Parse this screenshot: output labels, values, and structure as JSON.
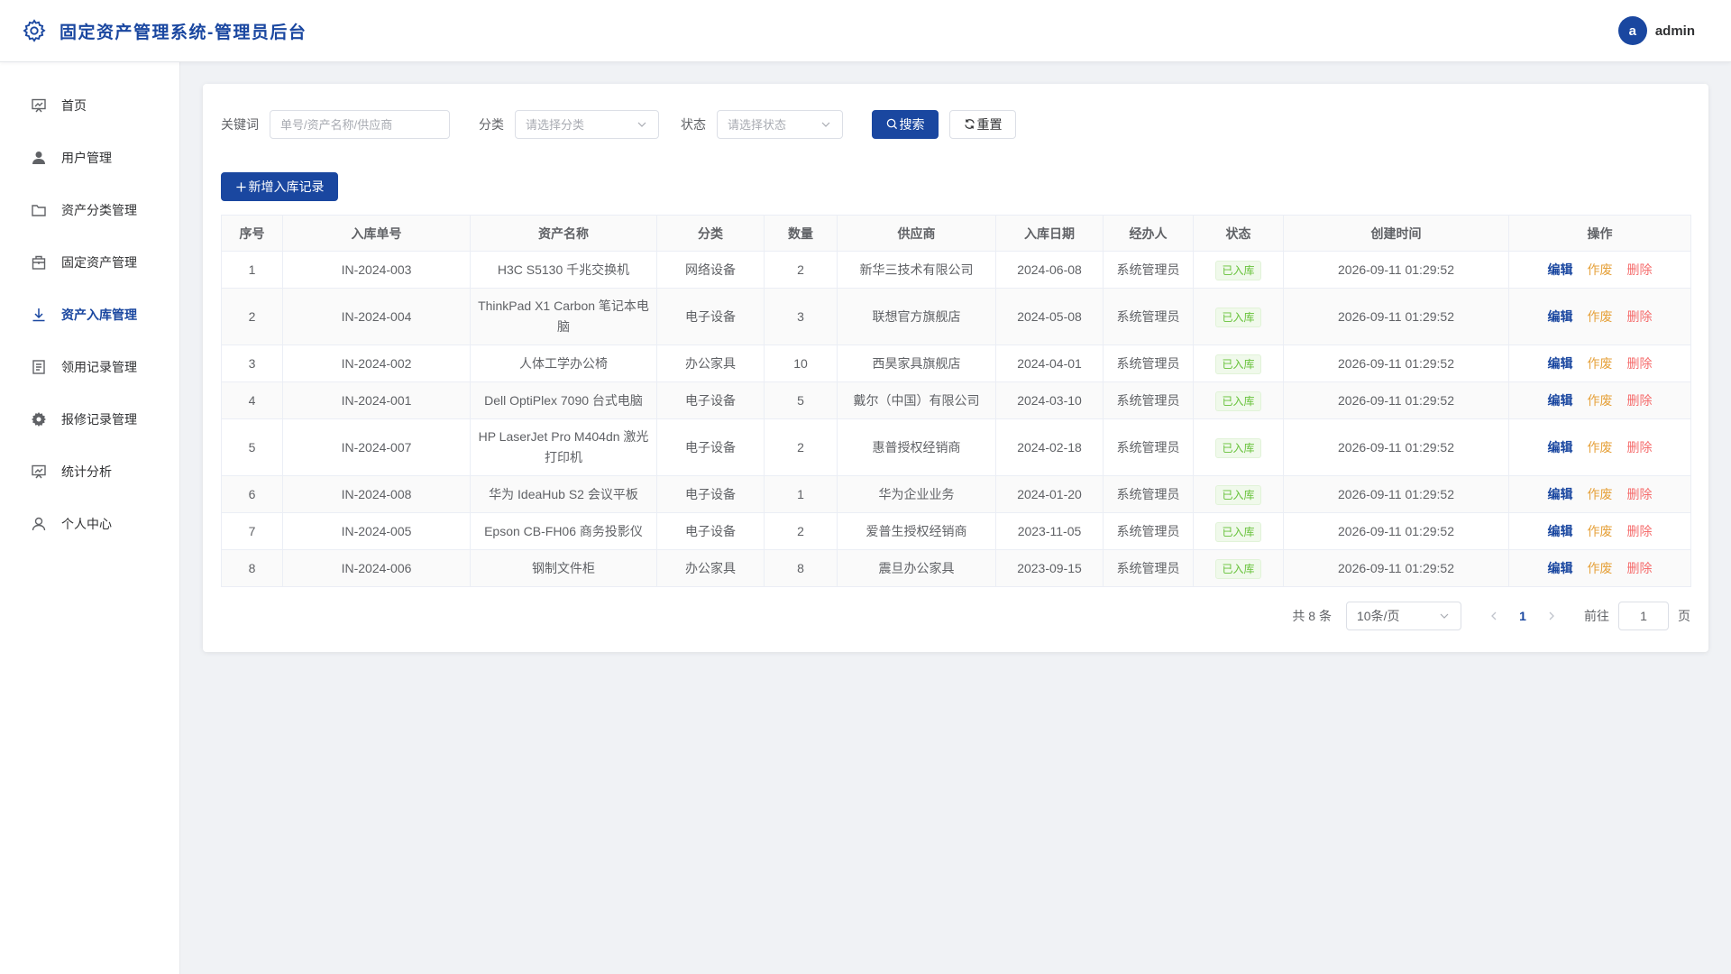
{
  "header": {
    "title": "固定资产管理系统-管理员后台",
    "avatar_letter": "a",
    "username": "admin"
  },
  "sidebar": {
    "items": [
      {
        "label": "首页",
        "icon": "monitor-chart-icon"
      },
      {
        "label": "用户管理",
        "icon": "user-filled-icon"
      },
      {
        "label": "资产分类管理",
        "icon": "folder-icon"
      },
      {
        "label": "固定资产管理",
        "icon": "briefcase-icon"
      },
      {
        "label": "资产入库管理",
        "icon": "download-icon",
        "active": true
      },
      {
        "label": "领用记录管理",
        "icon": "document-icon"
      },
      {
        "label": "报修记录管理",
        "icon": "gear-icon"
      },
      {
        "label": "统计分析",
        "icon": "monitor-chart-icon"
      },
      {
        "label": "个人中心",
        "icon": "user-icon"
      }
    ]
  },
  "filter": {
    "keyword_label": "关键词",
    "keyword_placeholder": "单号/资产名称/供应商",
    "category_label": "分类",
    "category_placeholder": "请选择分类",
    "status_label": "状态",
    "status_placeholder": "请选择状态",
    "search_label": "搜索",
    "reset_label": "重置"
  },
  "toolbar": {
    "add_label": "新增入库记录"
  },
  "table": {
    "headers": [
      "序号",
      "入库单号",
      "资产名称",
      "分类",
      "数量",
      "供应商",
      "入库日期",
      "经办人",
      "状态",
      "创建时间",
      "操作"
    ],
    "actions": {
      "edit": "编辑",
      "void": "作废",
      "delete": "删除"
    },
    "rows": [
      {
        "no": "1",
        "code": "IN-2024-003",
        "name": "H3C S5130 千兆交换机",
        "category": "网络设备",
        "qty": "2",
        "supplier": "新华三技术有限公司",
        "date": "2024-06-08",
        "handler": "系统管理员",
        "status": "已入库",
        "created": "2026-09-11 01:29:52"
      },
      {
        "no": "2",
        "code": "IN-2024-004",
        "name": "ThinkPad X1 Carbon 笔记本电脑",
        "category": "电子设备",
        "qty": "3",
        "supplier": "联想官方旗舰店",
        "date": "2024-05-08",
        "handler": "系统管理员",
        "status": "已入库",
        "created": "2026-09-11 01:29:52"
      },
      {
        "no": "3",
        "code": "IN-2024-002",
        "name": "人体工学办公椅",
        "category": "办公家具",
        "qty": "10",
        "supplier": "西昊家具旗舰店",
        "date": "2024-04-01",
        "handler": "系统管理员",
        "status": "已入库",
        "created": "2026-09-11 01:29:52"
      },
      {
        "no": "4",
        "code": "IN-2024-001",
        "name": "Dell OptiPlex 7090 台式电脑",
        "category": "电子设备",
        "qty": "5",
        "supplier": "戴尔（中国）有限公司",
        "date": "2024-03-10",
        "handler": "系统管理员",
        "status": "已入库",
        "created": "2026-09-11 01:29:52"
      },
      {
        "no": "5",
        "code": "IN-2024-007",
        "name": "HP LaserJet Pro M404dn 激光打印机",
        "category": "电子设备",
        "qty": "2",
        "supplier": "惠普授权经销商",
        "date": "2024-02-18",
        "handler": "系统管理员",
        "status": "已入库",
        "created": "2026-09-11 01:29:52"
      },
      {
        "no": "6",
        "code": "IN-2024-008",
        "name": "华为 IdeaHub S2 会议平板",
        "category": "电子设备",
        "qty": "1",
        "supplier": "华为企业业务",
        "date": "2024-01-20",
        "handler": "系统管理员",
        "status": "已入库",
        "created": "2026-09-11 01:29:52"
      },
      {
        "no": "7",
        "code": "IN-2024-005",
        "name": "Epson CB-FH06 商务投影仪",
        "category": "电子设备",
        "qty": "2",
        "supplier": "爱普生授权经销商",
        "date": "2023-11-05",
        "handler": "系统管理员",
        "status": "已入库",
        "created": "2026-09-11 01:29:52"
      },
      {
        "no": "8",
        "code": "IN-2024-006",
        "name": "钢制文件柜",
        "category": "办公家具",
        "qty": "8",
        "supplier": "震旦办公家具",
        "date": "2023-09-15",
        "handler": "系统管理员",
        "status": "已入库",
        "created": "2026-09-11 01:29:52"
      }
    ]
  },
  "pagination": {
    "total_text": "共 8 条",
    "page_size": "10条/页",
    "current_page": "1",
    "goto_label": "前往",
    "goto_value": "1",
    "page_suffix": "页"
  },
  "colors": {
    "primary": "#1a47a0",
    "success": "#67c23a",
    "warning": "#e6a23c",
    "danger": "#f56c6c"
  }
}
